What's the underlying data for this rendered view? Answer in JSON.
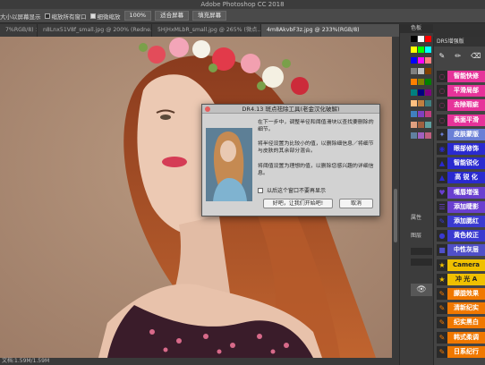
{
  "app": {
    "title": "Adobe Photoshop CC 2018"
  },
  "options_bar": {
    "scroll_all_label": "大小以屏幕显示",
    "zoom_all_label": "缩放所有窗口",
    "scrubby_label": "细微缩放",
    "zoom_value": "100%",
    "fit_screen": "适合屏幕",
    "fill_screen": "填充屏幕"
  },
  "tabs": [
    {
      "label": "7%RGB/8) ×",
      "active": false
    },
    {
      "label": "n8Lnx51V8f_small.jpg @ 200% (Redne...",
      "active": false
    },
    {
      "label": "5HjHxMLbR_small.jpg @ 265% (微点...",
      "active": false
    },
    {
      "label": "4m8AkvbF3z.jpg @ 233%(RGB/8)",
      "active": true
    }
  ],
  "status": {
    "text": "文档:1.59M/1.59M"
  },
  "mid_panel": {
    "swatches_title": "色板",
    "attributes_label": "属性",
    "layers_label": "图层",
    "swatch_colors": [
      "#000000",
      "#ffffff",
      "#ff0000",
      "#ffff00",
      "#00ff00",
      "#00ffff",
      "#0000ff",
      "#ff00ff",
      "#ff8080",
      "#808080",
      "#c0c0c0",
      "#804000",
      "#ff8000",
      "#808000",
      "#008000",
      "#008080",
      "#000080",
      "#800080",
      "#ffc080",
      "#c08040",
      "#408080",
      "#4080c0",
      "#8040c0",
      "#c04080",
      "#e0a080",
      "#a06040",
      "#60a0a0",
      "#6080a0",
      "#a060c0",
      "#c06080"
    ]
  },
  "dr_panel": {
    "title": "DR5增强版",
    "tool_icons": [
      "brush-icon",
      "pencil-icon",
      "eraser-icon"
    ],
    "buttons": [
      {
        "label": "智能快修",
        "color": "#e6339a",
        "icon": "lasso-icon"
      },
      {
        "label": "平滑局部",
        "color": "#e6339a",
        "icon": "lasso-icon"
      },
      {
        "label": "去除瑕疵",
        "color": "#e6339a",
        "icon": "lasso-icon"
      },
      {
        "label": "表面平滑",
        "color": "#e6339a",
        "icon": "lasso-icon"
      },
      {
        "label": "皮肤蒙版",
        "color": "#6a7fd6",
        "icon": "wand-icon"
      },
      {
        "label": "眼部修饰",
        "color": "#2a2ad0",
        "icon": "eye-icon"
      },
      {
        "label": "智能锐化",
        "color": "#2a2ad0",
        "icon": "triangle-icon"
      },
      {
        "label": "高 锐 化",
        "color": "#2a2ad0",
        "icon": "triangle-icon"
      },
      {
        "label": "嘴唇增强",
        "color": "#6a3fd0",
        "icon": "lips-icon"
      },
      {
        "label": "添加睫影",
        "color": "#6a3fd0",
        "icon": "eyelash-icon"
      },
      {
        "label": "添加腮红",
        "color": "#3a3ad0",
        "icon": "brush-icon"
      },
      {
        "label": "黄色校正",
        "color": "#3a3ad0",
        "icon": "drop-icon"
      },
      {
        "label": "中性灰层",
        "color": "#5050c8",
        "icon": "square-icon"
      },
      {
        "label": "Camera Raw",
        "color": "#f0c000",
        "icon": "star-icon"
      },
      {
        "label": "冲 光 A",
        "color": "#f0c000",
        "icon": "star-icon"
      },
      {
        "label": "朦胧效果",
        "color": "#f07800",
        "icon": "wrench-icon"
      },
      {
        "label": "清新纪实",
        "color": "#f07800",
        "icon": "wrench-icon"
      },
      {
        "label": "纪实黑白",
        "color": "#f07800",
        "icon": "wrench-icon"
      },
      {
        "label": "韩式柔调",
        "color": "#f07800",
        "icon": "wrench-icon"
      },
      {
        "label": "日系纪行",
        "color": "#f07800",
        "icon": "wrench-icon"
      }
    ]
  },
  "dialog": {
    "title": "DR4.13 斑点祛除工具(老金汉化破解)",
    "para1": "在下一步中，调整半径和阈值滑块以查找要删除的细节。",
    "para2": "将半径设置为比较小的值，以删除细信息／将细节与皮肤的其余部分混合。",
    "para3": "将阈值设置为理想的值，以删除您感兴趣的详细信息。",
    "checkbox_label": "以后这个窗口不要再显示",
    "ok_label": "好吧，让我们开始吧!",
    "cancel_label": "取消"
  }
}
